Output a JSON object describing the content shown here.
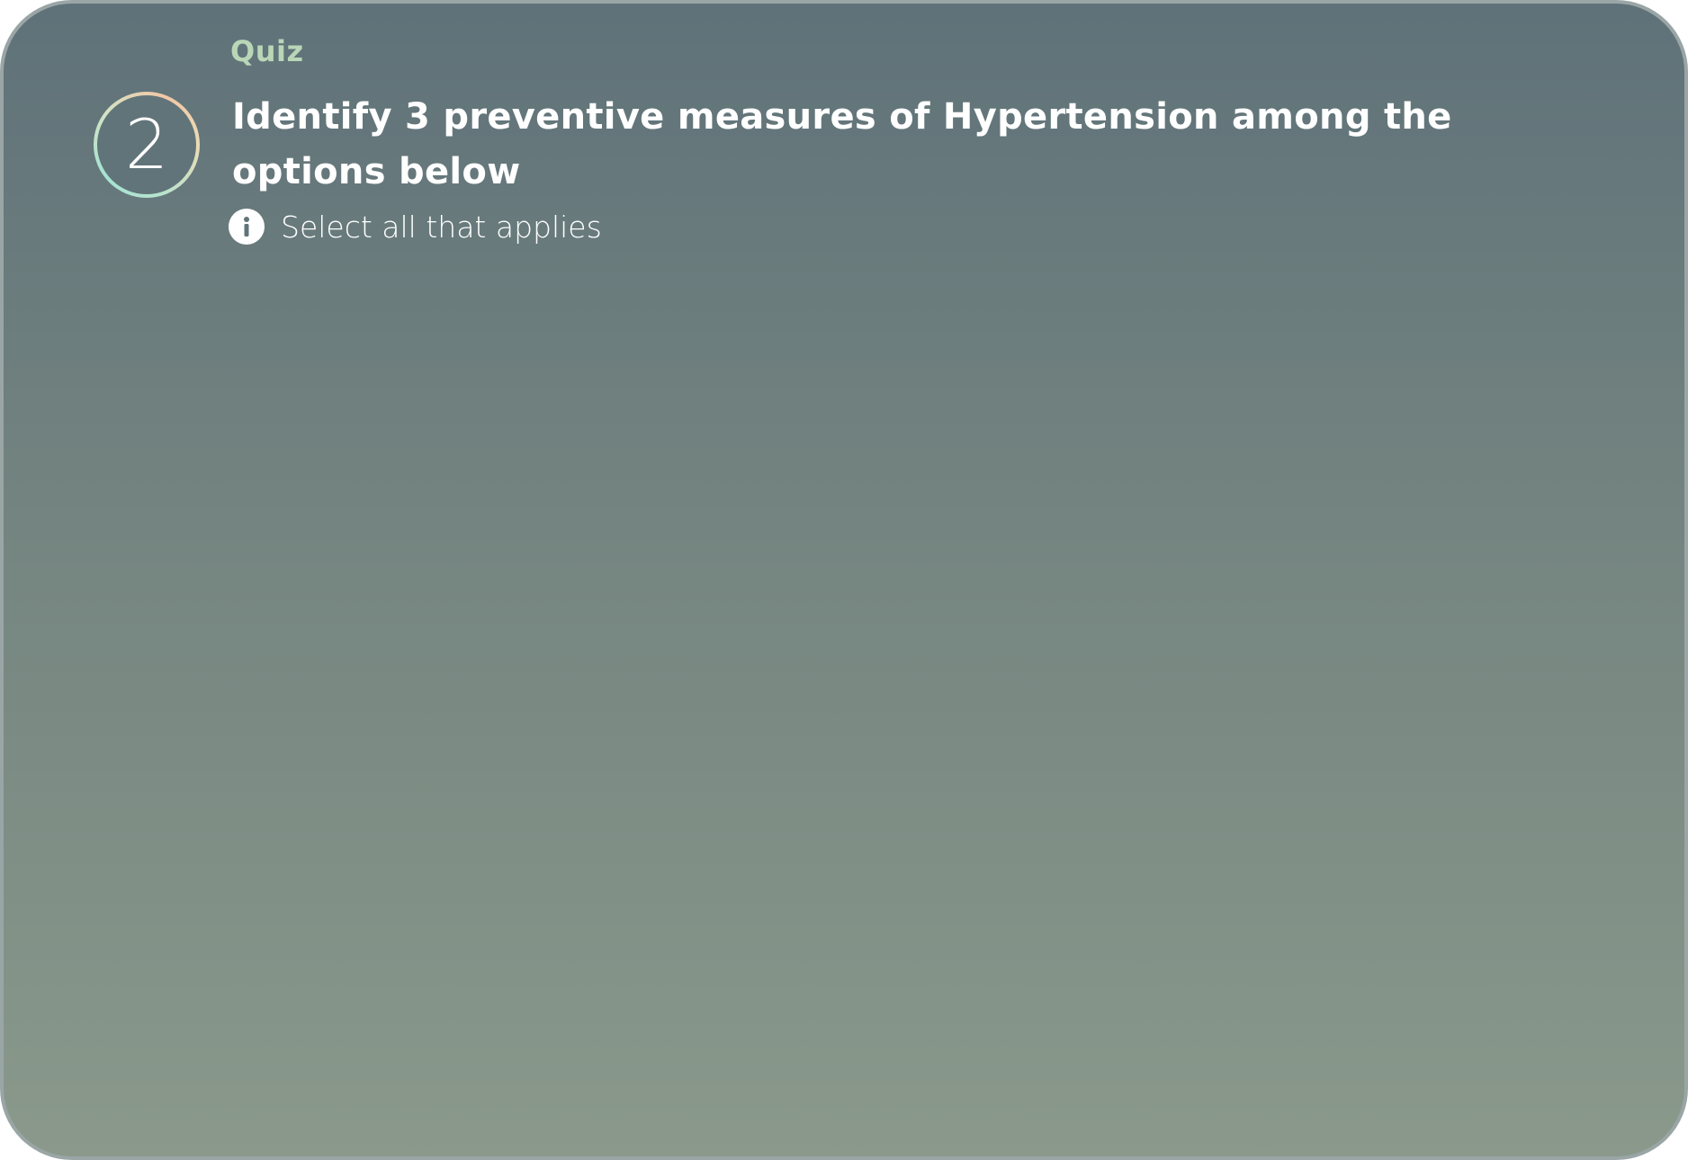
{
  "quiz": {
    "label": "Quiz",
    "number": "2",
    "question": "Identify 3 preventive measures of Hypertension among the options below",
    "hint_icon": "info-icon",
    "hint": "Select all that applies"
  },
  "colors": {
    "background_top": "#5f7279",
    "background_bottom": "#8a998b",
    "quiz_label": "#b9d6b7",
    "text": "#ffffff"
  }
}
